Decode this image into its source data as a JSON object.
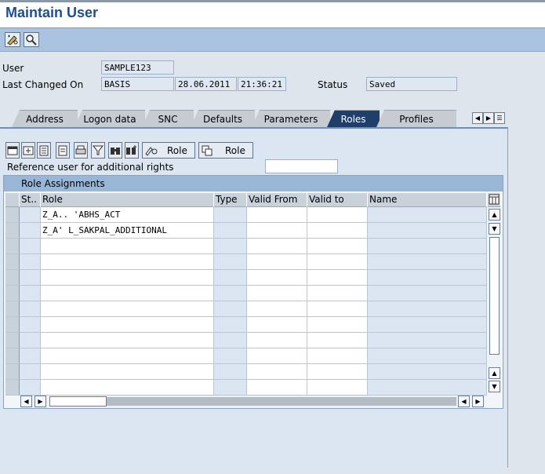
{
  "window": {
    "title": "Maintain User"
  },
  "toolbar": {
    "buttons": [
      {
        "name": "display-change-icon"
      },
      {
        "name": "other-user-icon"
      }
    ]
  },
  "form": {
    "user_label": "User",
    "user_value": "SAMPLE123",
    "last_changed_label": "Last Changed On",
    "last_changed_by": "BASIS",
    "last_changed_date": "28.06.2011",
    "last_changed_time": "21:36:21",
    "status_label": "Status",
    "status_value": "Saved"
  },
  "tabs": [
    {
      "label": "Address",
      "active": false
    },
    {
      "label": "Logon data",
      "active": false
    },
    {
      "label": "SNC",
      "active": false
    },
    {
      "label": "Defaults",
      "active": false
    },
    {
      "label": "Parameters",
      "active": false
    },
    {
      "label": "Roles",
      "active": true
    },
    {
      "label": "Profiles",
      "active": false
    }
  ],
  "roles_tab": {
    "role_button_1": "Role",
    "role_button_2": "Role",
    "reference_user_label": "Reference user for additional rights",
    "reference_user_value": "",
    "table_title": "Role Assignments",
    "columns": {
      "status": "St..",
      "role": "Role",
      "type": "Type",
      "valid_from": "Valid From",
      "valid_to": "Valid to",
      "name": "Name"
    },
    "rows": [
      {
        "role": "Z_A.. 'ABHS_ACT",
        "type": "",
        "valid_from": "",
        "valid_to": "",
        "name": ""
      },
      {
        "role": "Z_A' L_SAKPAL_ADDITIONAL",
        "type": "",
        "valid_from": "",
        "valid_to": "",
        "name": ""
      },
      {
        "role": "",
        "type": "",
        "valid_from": "",
        "valid_to": "",
        "name": ""
      },
      {
        "role": "",
        "type": "",
        "valid_from": "",
        "valid_to": "",
        "name": ""
      },
      {
        "role": "",
        "type": "",
        "valid_from": "",
        "valid_to": "",
        "name": ""
      },
      {
        "role": "",
        "type": "",
        "valid_from": "",
        "valid_to": "",
        "name": ""
      },
      {
        "role": "",
        "type": "",
        "valid_from": "",
        "valid_to": "",
        "name": ""
      },
      {
        "role": "",
        "type": "",
        "valid_from": "",
        "valid_to": "",
        "name": ""
      },
      {
        "role": "",
        "type": "",
        "valid_from": "",
        "valid_to": "",
        "name": ""
      },
      {
        "role": "",
        "type": "",
        "valid_from": "",
        "valid_to": "",
        "name": ""
      },
      {
        "role": "",
        "type": "",
        "valid_from": "",
        "valid_to": "",
        "name": ""
      },
      {
        "role": "",
        "type": "",
        "valid_from": "",
        "valid_to": "",
        "name": ""
      }
    ]
  },
  "colors": {
    "title": "#1e4e8c",
    "toolbar": "#a9c3e0",
    "active_tab": "#1f3e6a",
    "panel": "#dbe6f2"
  }
}
